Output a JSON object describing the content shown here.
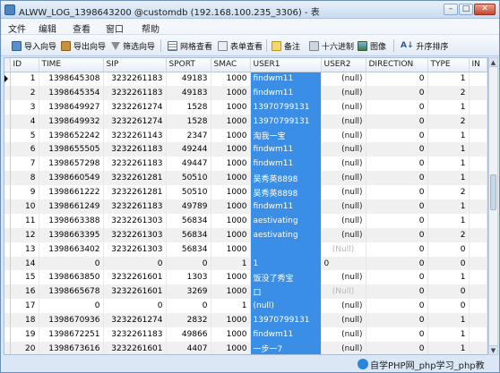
{
  "window": {
    "title": "ALWW_LOG_1398643200 @customdb (192.168.100.235_3306) - 表"
  },
  "menu": [
    "文件",
    "编辑",
    "查看",
    "窗口",
    "帮助"
  ],
  "toolbar": {
    "import_wizard": "导入向导",
    "export_wizard": "导出向导",
    "filter_wizard": "筛选向导",
    "grid_view": "网格查看",
    "form_view": "表单查看",
    "memo": "备注",
    "hex": "十六进制",
    "image": "图像",
    "sort_asc": "升序排序"
  },
  "table": {
    "columns": [
      "ID",
      "TIME",
      "SIP",
      "SPORT",
      "SMAC",
      "USER1",
      "USER2",
      "DIRECTION",
      "TYPE",
      "IN"
    ],
    "rows": [
      [
        "1",
        "1398645308",
        "3232261183",
        "49183",
        "1000",
        "findwm11",
        "(null)",
        "0",
        "1"
      ],
      [
        "2",
        "1398645354",
        "3232261183",
        "49183",
        "1000",
        "findwm11",
        "(null)",
        "0",
        "2"
      ],
      [
        "3",
        "1398649927",
        "3232261274",
        "1528",
        "1000",
        "13970799131",
        "(null)",
        "0",
        "1"
      ],
      [
        "4",
        "1398649932",
        "3232261274",
        "1528",
        "1000",
        "13970799131",
        "(null)",
        "0",
        "2"
      ],
      [
        "5",
        "1398652242",
        "3232261143",
        "2347",
        "1000",
        "淘我一宝",
        "(null)",
        "0",
        "1"
      ],
      [
        "6",
        "1398655505",
        "3232261183",
        "49244",
        "1000",
        "findwm11",
        "(null)",
        "0",
        "1"
      ],
      [
        "7",
        "1398657298",
        "3232261183",
        "49447",
        "1000",
        "findwm11",
        "(null)",
        "0",
        "1"
      ],
      [
        "8",
        "1398660549",
        "3232261281",
        "50510",
        "1000",
        "吴秀英8898",
        "(null)",
        "0",
        "1"
      ],
      [
        "9",
        "1398661222",
        "3232261281",
        "50510",
        "1000",
        "吴秀英8898",
        "(null)",
        "0",
        "2"
      ],
      [
        "10",
        "1398661249",
        "3232261183",
        "49789",
        "1000",
        "findwm11",
        "(null)",
        "0",
        "1"
      ],
      [
        "11",
        "1398663388",
        "3232261303",
        "56834",
        "1000",
        "aestivating",
        "(null)",
        "0",
        "1"
      ],
      [
        "12",
        "1398663395",
        "3232261303",
        "56834",
        "1000",
        "aestivating",
        "(null)",
        "0",
        "2"
      ],
      [
        "13",
        "1398663402",
        "3232261303",
        "56834",
        "1000",
        "",
        "(Null)",
        "0",
        "0"
      ],
      [
        "14",
        "0",
        "0",
        "0",
        "1",
        "1",
        "0",
        "0",
        "0"
      ],
      [
        "15",
        "1398663850",
        "3232261601",
        "1303",
        "1000",
        "饭没了秀宝",
        "(null)",
        "0",
        "1"
      ],
      [
        "16",
        "1398665678",
        "3232261601",
        "3269",
        "1000",
        "口",
        "(Null)",
        "0",
        "0"
      ],
      [
        "17",
        "0",
        "0",
        "0",
        "1",
        "(null)",
        "(null)",
        "0",
        "0"
      ],
      [
        "18",
        "1398670936",
        "3232261274",
        "2832",
        "1000",
        "13970799131",
        "(null)",
        "0",
        "1"
      ],
      [
        "19",
        "1398672251",
        "3232261183",
        "49866",
        "1000",
        "findwm11",
        "(null)",
        "0",
        "1"
      ],
      [
        "20",
        "1398673616",
        "3232261601",
        "4407",
        "1000",
        "一步一7",
        "(null)",
        "0",
        "1"
      ]
    ]
  },
  "watermark": "自学PHP网_php学习_php教"
}
